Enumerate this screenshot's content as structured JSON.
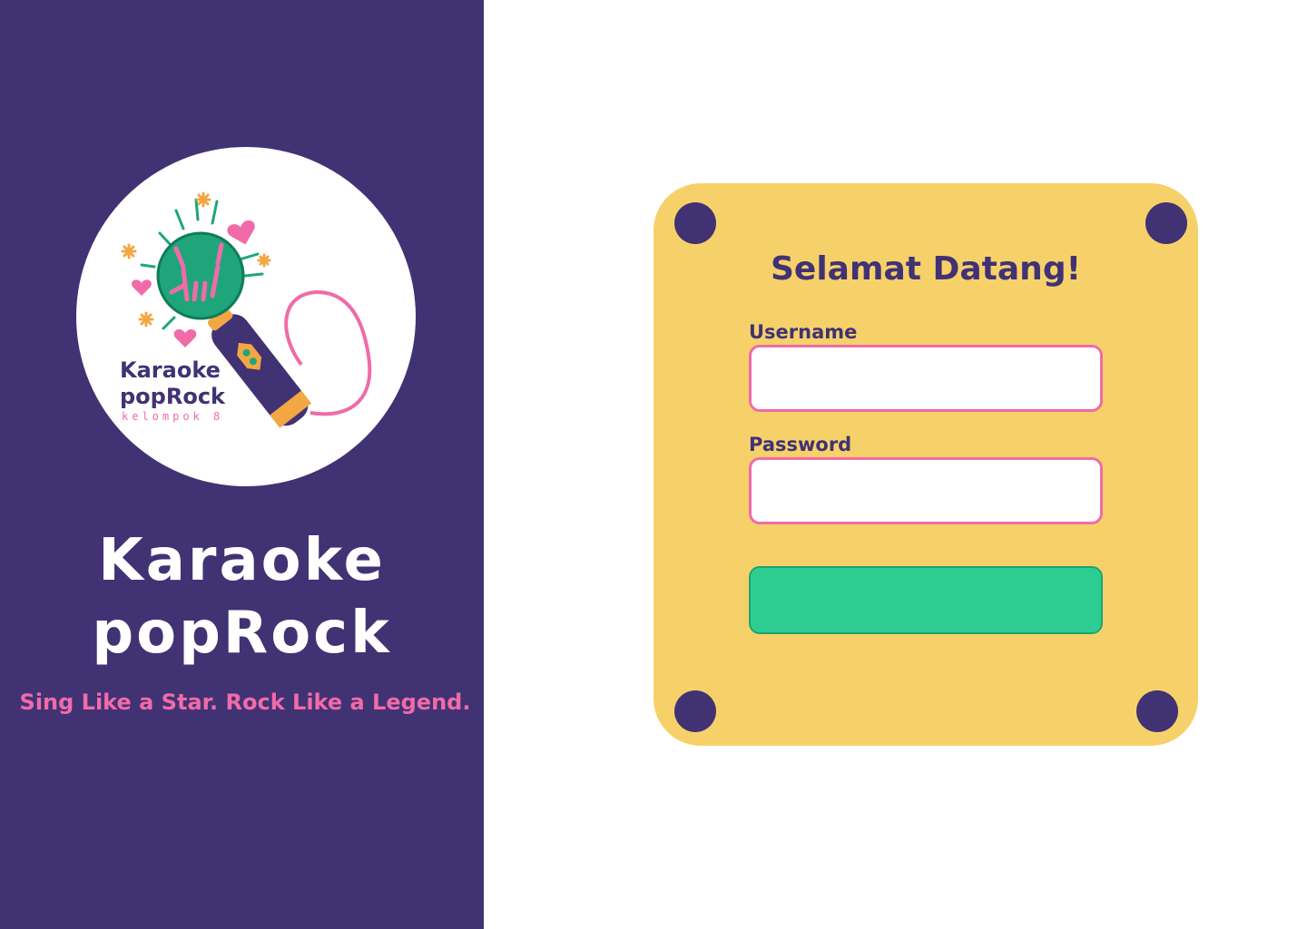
{
  "sidebar": {
    "logo": {
      "line1": "Karaoke",
      "line2": "popRock",
      "subtitle": "kelompok 8"
    },
    "title_line1": "Karaoke",
    "title_line2": "popRock",
    "tagline": "Sing Like a Star. Rock Like a Legend."
  },
  "login": {
    "title": "Selamat Datang!",
    "username_label": "Username",
    "username_value": "",
    "password_label": "Password",
    "password_value": "",
    "submit_label": ""
  },
  "colors": {
    "sidebar_bg": "#413274",
    "card_bg": "#f6d16a",
    "accent_pink": "#f06ba8",
    "button_green": "#2dcd91",
    "dot_purple": "#413274"
  },
  "icons": {
    "logo": "microphone-rock-hand-icon"
  }
}
